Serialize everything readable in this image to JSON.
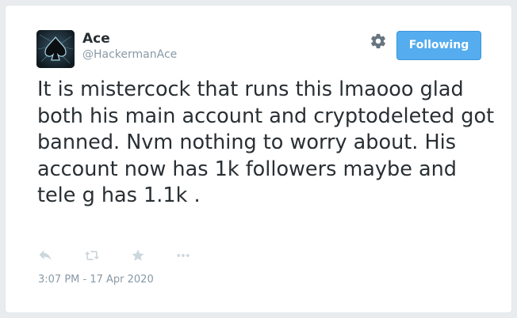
{
  "user": {
    "display_name": "Ace",
    "handle": "@HackermanAce"
  },
  "header": {
    "settings_icon": "gear-icon",
    "follow_label": "Following",
    "follow_color": "#55acee"
  },
  "tweet": {
    "text": "It is mistercock that runs this lmaooo glad both his main account and cryptodeleted got banned. Nvm nothing to worry about. His account now has 1k followers maybe and tele g has 1.1k .",
    "timestamp": "3:07 PM - 17 Apr 2020"
  },
  "actions": {
    "icons": [
      "reply-icon",
      "retweet-icon",
      "like-icon",
      "more-icon"
    ],
    "icon_color": "#ccd6dd"
  }
}
